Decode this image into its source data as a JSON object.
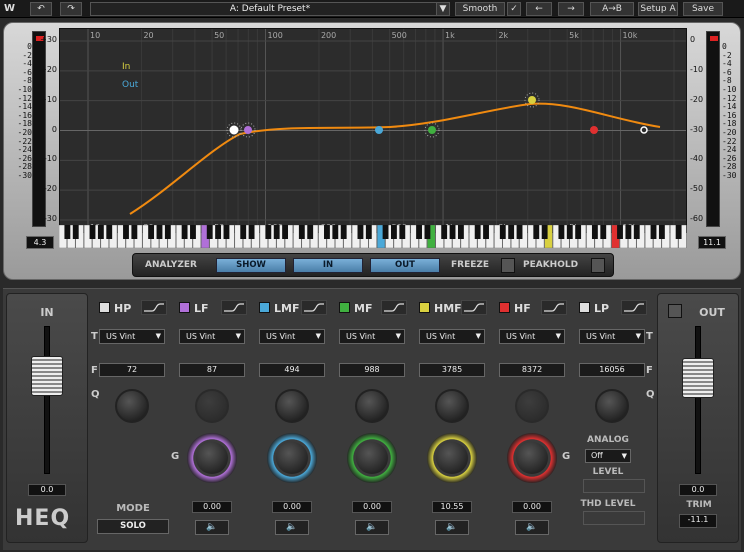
{
  "toolbar": {
    "undo_icon": "undo-icon",
    "redo_icon": "redo-icon",
    "preset_name": "A: Default Preset*",
    "smooth_label": "Smooth",
    "smooth_checked": true,
    "ab_label": "A→B",
    "setup_label": "Setup A",
    "save_label": "Save"
  },
  "meters": {
    "scale": [
      "0",
      "-2",
      "-4",
      "-6",
      "-8",
      "-10",
      "-12",
      "-14",
      "-16",
      "-18",
      "-20",
      "-22",
      "-24",
      "-26",
      "-28",
      "-30"
    ],
    "in_value": "4.3",
    "out_value": "11.1"
  },
  "graph": {
    "db_ticks_left": [
      "+30",
      "+20",
      "+10",
      "0",
      "-10",
      "-20",
      "-30"
    ],
    "db_ticks_right": [
      "0",
      "-10",
      "-20",
      "-30",
      "-40",
      "-50",
      "-60"
    ],
    "freq_ticks": [
      "10",
      "20",
      "50",
      "100",
      "200",
      "500",
      "1k",
      "2k",
      "5k",
      "10k"
    ],
    "legend_in": "In",
    "legend_out": "Out"
  },
  "analyzer": {
    "label": "ANALYZER",
    "show_label": "SHOW",
    "in_label": "IN",
    "out_label": "OUT",
    "freeze_label": "FREEZE",
    "peakhold_label": "PEAKHOLD"
  },
  "in_panel": {
    "title": "IN",
    "value": "0.0",
    "logo": "HEQ"
  },
  "out_panel": {
    "title": "OUT",
    "value": "0.0",
    "trim_label": "TRIM",
    "trim_value": "-11.1"
  },
  "row_labels": {
    "t": "T",
    "f": "F",
    "q": "Q",
    "g": "G"
  },
  "mode": {
    "label": "MODE",
    "value": "SOLO"
  },
  "analog": {
    "label": "ANALOG",
    "value": "Off",
    "level_label": "LEVEL",
    "thd_label": "THD LEVEL"
  },
  "bands": [
    {
      "name": "HP",
      "color": "#dddddd",
      "type": "US Vint",
      "freq": "72",
      "gain": "",
      "q_enabled": true
    },
    {
      "name": "LF",
      "color": "#b070d8",
      "type": "US Vint",
      "freq": "87",
      "gain": "0.00",
      "q_enabled": false
    },
    {
      "name": "LMF",
      "color": "#4aa8d8",
      "type": "US Vint",
      "freq": "494",
      "gain": "0.00",
      "q_enabled": true
    },
    {
      "name": "MF",
      "color": "#40b040",
      "type": "US Vint",
      "freq": "988",
      "gain": "0.00",
      "q_enabled": true
    },
    {
      "name": "HMF",
      "color": "#d8d040",
      "type": "US Vint",
      "freq": "3785",
      "gain": "10.55",
      "q_enabled": true
    },
    {
      "name": "HF",
      "color": "#e03030",
      "type": "US Vint",
      "freq": "8372",
      "gain": "0.00",
      "q_enabled": false
    },
    {
      "name": "LP",
      "color": "#dddddd",
      "type": "US Vint",
      "freq": "16056",
      "gain": "",
      "q_enabled": true
    }
  ]
}
